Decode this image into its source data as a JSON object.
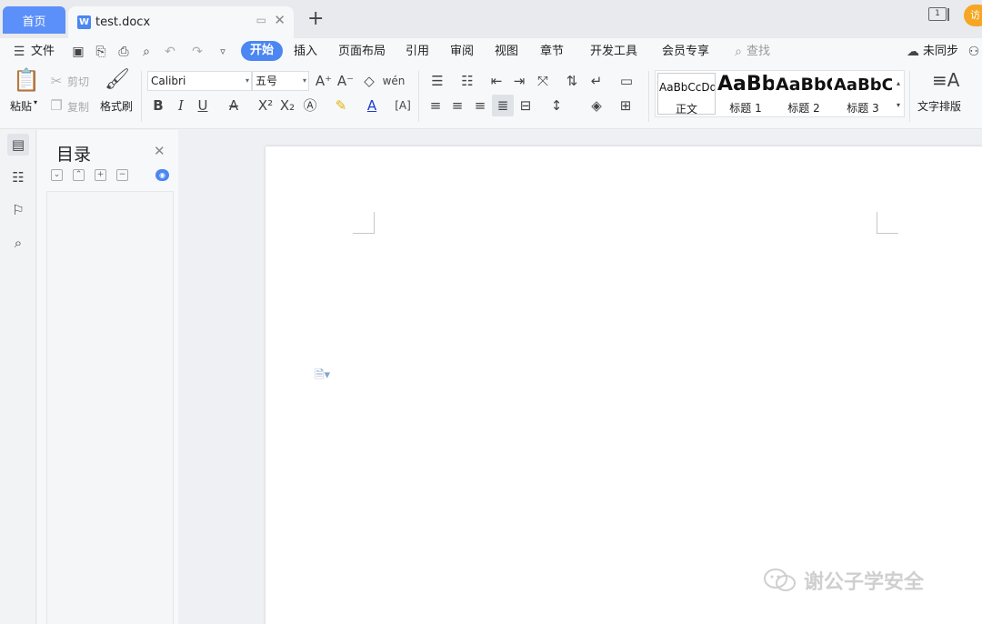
{
  "tabs": {
    "home": "首页",
    "doc_name": "test.docx",
    "doc_icon": "W",
    "add": "+"
  },
  "window": {
    "counter": "1",
    "avatar": "访"
  },
  "menu": {
    "file": "文件",
    "items": [
      "开始",
      "插入",
      "页面布局",
      "引用",
      "审阅",
      "视图",
      "章节",
      "开发工具",
      "会员专享"
    ],
    "search": "查找",
    "sync": "未同步"
  },
  "ribbon": {
    "paste": "粘贴",
    "cut": "剪切",
    "copy": "复制",
    "format_painter": "格式刷",
    "font_name": "Calibri",
    "font_size": "五号",
    "styles": [
      {
        "sample": "AaBbCcDd",
        "name": "正文"
      },
      {
        "sample": "AaBb",
        "name": "标题 1"
      },
      {
        "sample": "AaBbC",
        "name": "标题 2"
      },
      {
        "sample": "AaBbC",
        "name": "标题 3"
      }
    ],
    "text_layout": "文字排版"
  },
  "toc": {
    "title": "目录"
  },
  "watermark": "谢公子学安全",
  "colors": {
    "accent": "#4b86f3",
    "home_tab": "#5b8ff9",
    "avatar": "#f5a623"
  }
}
